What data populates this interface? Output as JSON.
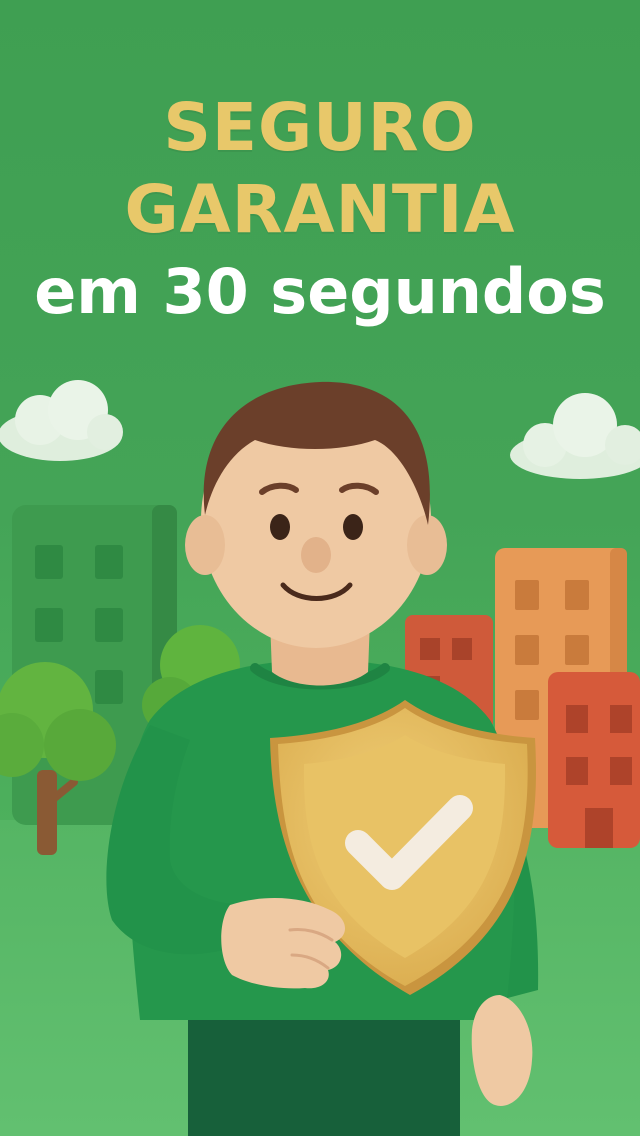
{
  "headline": {
    "line1": "SEGURO",
    "line2": "GARANTIA",
    "line3": "em 30 segundos"
  },
  "colors": {
    "background": "#44a457",
    "headline_accent": "#e8c86a",
    "headline_secondary": "#ffffff",
    "shield": "#e2b85a",
    "check": "#f4ece0",
    "sweater": "#22934a",
    "pants": "#17603a",
    "skin": "#efc9a3",
    "hair": "#6b3f2a"
  },
  "icons": [
    "cloud-icon",
    "building-icon",
    "tree-icon",
    "shield-check-icon",
    "person-illustration"
  ]
}
